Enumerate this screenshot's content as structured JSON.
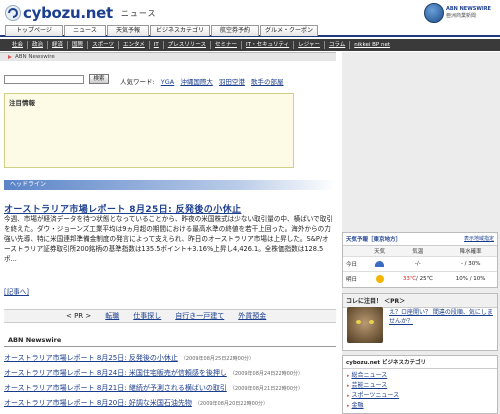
{
  "header": {
    "logo_text": "cybozu.net",
    "section": "ニュース",
    "badge_line1": "ABN NEWSWIRE",
    "badge_line2": "亜洲商業新聞"
  },
  "tabs": [
    "トップページ",
    "ニュース",
    "天気予報",
    "ビジネスカテゴリ",
    "航空券予約",
    "グルメ・クーポン"
  ],
  "subnav": [
    "社会",
    "政治",
    "経済",
    "国際",
    "スポーツ",
    "エンタメ",
    "IT",
    "プレスリリース",
    "セミナー",
    "IT・セキュリティ",
    "レジャー",
    "コラム",
    "nikkei BP net"
  ],
  "breadcrumb": {
    "label": "ABN Newswire"
  },
  "search": {
    "button": "検索",
    "popular_label": "人気ワード:",
    "keywords": [
      "YGA",
      "沖縄国際大",
      "羽田空港",
      "歌手の部屋"
    ]
  },
  "notice": {
    "title": "注目情報"
  },
  "headline_bar": "ヘッドライン",
  "article": {
    "title": "オーストラリア市場レポート 8月25日: 反発後の小休止",
    "body": "今週、市場が経済データを待つ状態となっていることから、昨夜の米国株式は少ない取引量の中、横ばいで取引を終えた。ダウ・ジョーンズ工業平均は9ヵ月超の期間における最高水準の終値を若干上回った。海外からの力強い先導、特に米国連邦準備金制度の発言によって支えられ、昨日のオーストラリア市場は上昇した。S&P/オーストラリア証券取引所200銘柄の基準指数は135.5ポイント+3.16%上昇し4,426.1。全株価指数は128.5ポ...",
    "more": "[記事へ]"
  },
  "related": {
    "pr": "< PR >",
    "links": [
      "転職",
      "仕事探し",
      "自行き一戸建て",
      "外貨預金"
    ]
  },
  "abn": {
    "title": "ABN Newswire",
    "items": [
      {
        "title": "オーストラリア市場レポート 8月25日: 反発後の小休止",
        "date": "（2009年08月25日22時00分）"
      },
      {
        "title": "オーストラリア市場レポート 8月24日: 米国住宅販売が信頼感を後押し",
        "date": "（2009年08月24日22時00分）"
      },
      {
        "title": "オーストラリア市場レポート 8月21日: 継続が予測される横ばいの取引",
        "date": "（2009年08月21日22時00分）"
      },
      {
        "title": "オーストラリア市場レポート 8月20日: 好調な米国石油先物",
        "date": "（2009年08月20日22時00分）"
      }
    ]
  },
  "weather": {
    "title": "天気予報［東京地方］",
    "link": "表示地域指定",
    "headers": [
      "",
      "天気",
      "気温",
      "降水確率"
    ],
    "rows": [
      {
        "day": "今日",
        "icon": "rain-icon",
        "temp_hi": "",
        "temp_lo": "-/-",
        "rain": "- / 30%"
      },
      {
        "day": "明日",
        "icon": "sun-icon",
        "temp_hi": "33℃",
        "temp_lo": "/ 25℃",
        "rain": "10% / 10%"
      }
    ]
  },
  "pr_box": {
    "title": "コレに注目！ ＜PR＞",
    "text": "え？ロ座開い？ 間違の段順、気にしませんか？"
  },
  "category": {
    "title": "cybozu.net ビジネスカテゴリ",
    "items": [
      "総合ニュース",
      "芸能ニュース",
      "スポーツニュース",
      "金融"
    ]
  },
  "colors": {
    "brand": "#1d3f8f",
    "nav_dark": "#3a3a3a",
    "headline": "#5a84c8",
    "sidebar": "#ececec"
  }
}
